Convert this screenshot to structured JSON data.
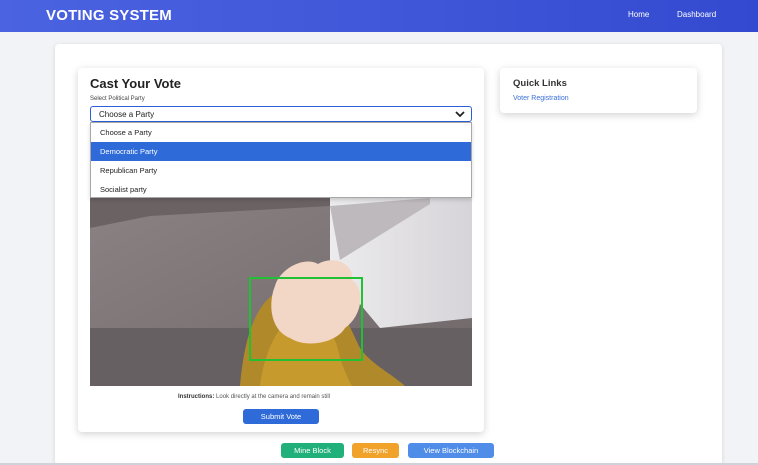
{
  "navbar": {
    "brand": "VOTING SYSTEM",
    "links": [
      "Home",
      "Dashboard"
    ]
  },
  "vote": {
    "title": "Cast Your Vote",
    "party_label": "Select Political Party",
    "selected_value": "Choose a Party",
    "options": [
      "Choose a Party",
      "Democratic Party",
      "Republican Party",
      "Socialist party"
    ],
    "highlighted_option": "Democratic Party",
    "instructions_label": "Instructions:",
    "instructions_text": "Look directly at the camera and remain still",
    "submit_label": "Submit Vote"
  },
  "actions": {
    "mine_label": "Mine Block",
    "resync_label": "Resync",
    "view_label": "View Blockchain"
  },
  "quick_links": {
    "title": "Quick Links",
    "links": [
      "Voter Registration"
    ]
  },
  "colors": {
    "primary": "#3f55d8",
    "submit": "#2f6ad9",
    "mine": "#21b07a",
    "resync": "#f0a22a",
    "view": "#4f8de8",
    "face_box": "#22c033"
  },
  "icons": {
    "caret": "chevron-down-icon"
  }
}
